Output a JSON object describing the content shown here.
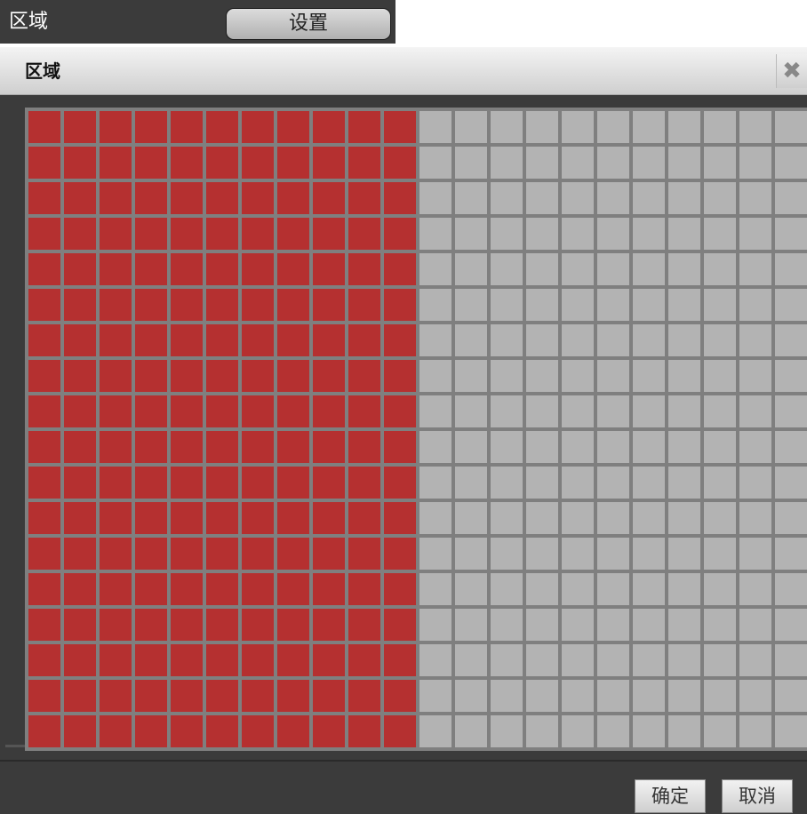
{
  "field": {
    "label": "区域",
    "button_label": "设置"
  },
  "dialog": {
    "title": "区域",
    "close_icon": "close-icon",
    "ok_label": "确定",
    "cancel_label": "取消"
  },
  "grid": {
    "visible_columns": 22,
    "visible_rows": 18,
    "selected_columns": 11,
    "selected_color": "#b53030",
    "unselected_color": "#b3b3b3"
  }
}
